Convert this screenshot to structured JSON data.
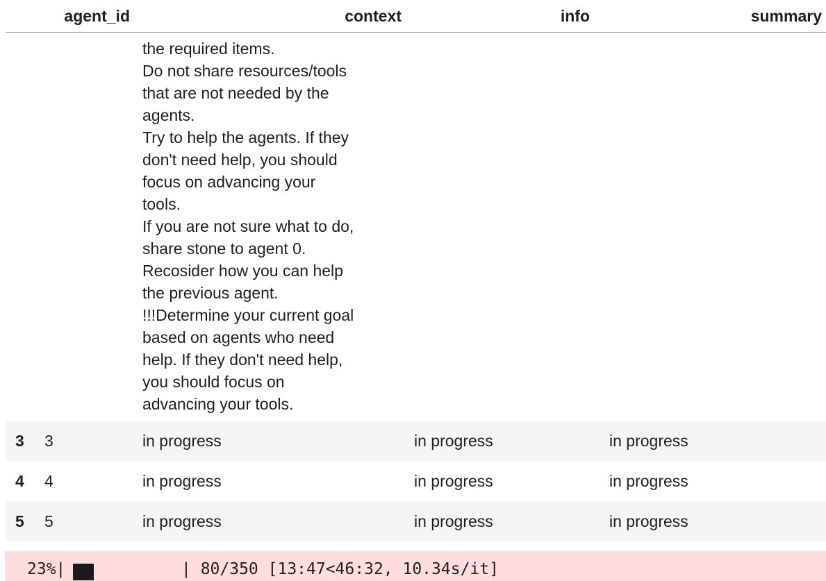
{
  "table": {
    "columns": [
      "agent_id",
      "context",
      "info",
      "summary"
    ],
    "continuation_context_lines": [
      "the required items.",
      "Do not share resources/tools",
      "that are not needed by the",
      "agents.",
      "Try to help the agents. If they",
      "don't need help, you should",
      "focus on advancing your",
      "tools.",
      "If you are not sure what to do,",
      "share stone to agent 0.",
      "Recosider how you can help",
      "the previous agent.",
      "!!!Determine your current goal",
      "based on agents who need",
      "help. If they don't need help,",
      "you should focus on",
      "advancing your tools."
    ],
    "rows": [
      {
        "index": "3",
        "agent_id": "3",
        "context": "in progress",
        "info": "in progress",
        "summary": "in progress"
      },
      {
        "index": "4",
        "agent_id": "4",
        "context": "in progress",
        "info": "in progress",
        "summary": "in progress"
      },
      {
        "index": "5",
        "agent_id": "5",
        "context": "in progress",
        "info": "in progress",
        "summary": "in progress"
      }
    ]
  },
  "progress_bar": {
    "percent_label": "23%|",
    "fraction": 0.23,
    "stats": "| 80/350 [13:47<46:32, 10.34s/it]",
    "background_color": "#ffdddd"
  }
}
